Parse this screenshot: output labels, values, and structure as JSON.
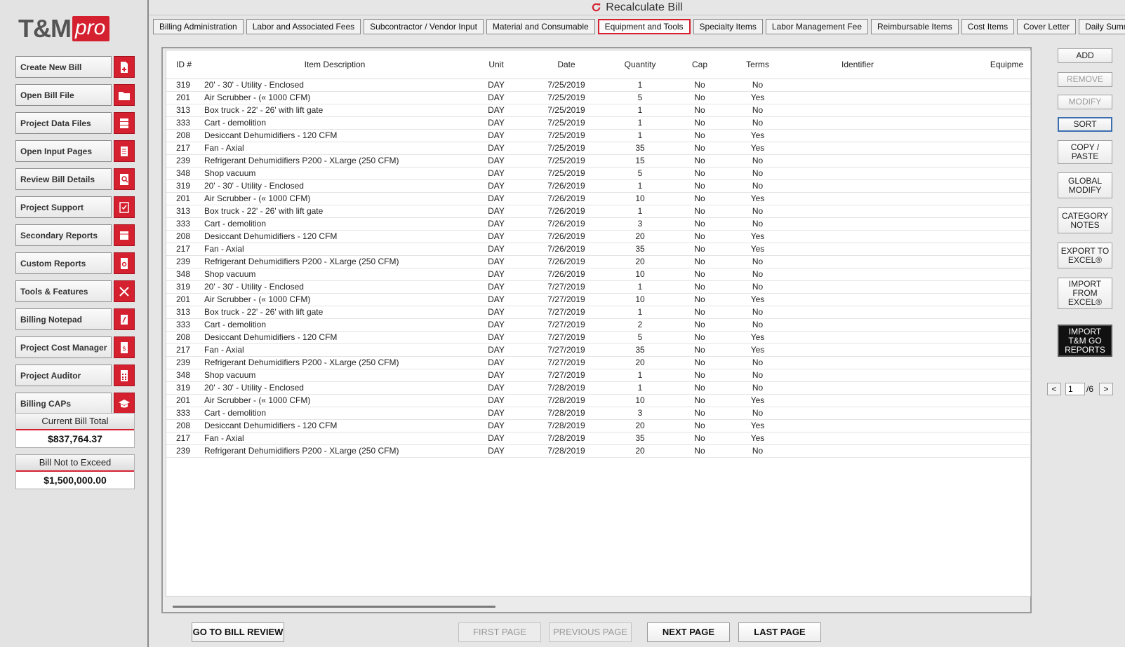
{
  "logo": {
    "tm": "T&M",
    "pro": "pro"
  },
  "sidebar": {
    "items": [
      {
        "label": "Create New Bill",
        "icon": "new-document-icon"
      },
      {
        "label": "Open Bill File",
        "icon": "folder-icon"
      },
      {
        "label": "Project Data Files",
        "icon": "database-icon"
      },
      {
        "label": "Open Input Pages",
        "icon": "input-pages-icon"
      },
      {
        "label": "Review Bill Details",
        "icon": "magnifier-icon"
      },
      {
        "label": "Project Support",
        "icon": "checklist-icon"
      },
      {
        "label": "Secondary Reports",
        "icon": "report-icon"
      },
      {
        "label": "Custom Reports",
        "icon": "gear-document-icon"
      },
      {
        "label": "Tools & Features",
        "icon": "tools-icon"
      },
      {
        "label": "Billing Notepad",
        "icon": "notepad-icon"
      },
      {
        "label": "Project Cost Manager",
        "icon": "dollar-document-icon"
      },
      {
        "label": "Project Auditor",
        "icon": "calculator-icon"
      },
      {
        "label": "Billing CAPs",
        "icon": "graduation-cap-icon"
      }
    ],
    "current_total": {
      "title": "Current Bill Total",
      "value": "$837,764.37"
    },
    "not_to_exceed": {
      "title": "Bill Not to Exceed",
      "value": "$1,500,000.00"
    }
  },
  "header": {
    "recalculate_label": "Recalculate Bill",
    "recalculate_icon": "refresh-icon"
  },
  "tabs": [
    {
      "label": "Billing Administration",
      "active": false
    },
    {
      "label": "Labor and Associated Fees",
      "active": false
    },
    {
      "label": "Subcontractor / Vendor Input",
      "active": false
    },
    {
      "label": "Material and Consumable",
      "active": false
    },
    {
      "label": "Equipment and Tools",
      "active": true
    },
    {
      "label": "Specialty Items",
      "active": false
    },
    {
      "label": "Labor Management Fee",
      "active": false
    },
    {
      "label": "Reimbursable Items",
      "active": false
    },
    {
      "label": "Cost Items",
      "active": false
    },
    {
      "label": "Cover Letter",
      "active": false
    },
    {
      "label": "Daily Summary",
      "active": false
    }
  ],
  "table": {
    "columns": [
      "ID #",
      "Item Description",
      "Unit",
      "Date",
      "Quantity",
      "Cap",
      "Terms",
      "Identifier",
      "Equipme"
    ],
    "rows": [
      [
        "319",
        "20' - 30' - Utility - Enclosed",
        "DAY",
        "7/25/2019",
        "1",
        "No",
        "No",
        ""
      ],
      [
        "201",
        "Air Scrubber - (« 1000 CFM)",
        "DAY",
        "7/25/2019",
        "5",
        "No",
        "Yes",
        ""
      ],
      [
        "313",
        "Box truck - 22' - 26' with lift gate",
        "DAY",
        "7/25/2019",
        "1",
        "No",
        "No",
        ""
      ],
      [
        "333",
        "Cart - demolition",
        "DAY",
        "7/25/2019",
        "1",
        "No",
        "No",
        ""
      ],
      [
        "208",
        "Desiccant Dehumidifiers - 120 CFM",
        "DAY",
        "7/25/2019",
        "1",
        "No",
        "Yes",
        ""
      ],
      [
        "217",
        "Fan - Axial",
        "DAY",
        "7/25/2019",
        "35",
        "No",
        "Yes",
        ""
      ],
      [
        "239",
        "Refrigerant Dehumidifiers P200 - XLarge (250 CFM)",
        "DAY",
        "7/25/2019",
        "15",
        "No",
        "No",
        ""
      ],
      [
        "348",
        "Shop vacuum",
        "DAY",
        "7/25/2019",
        "5",
        "No",
        "No",
        ""
      ],
      [
        "319",
        "20' - 30' - Utility - Enclosed",
        "DAY",
        "7/26/2019",
        "1",
        "No",
        "No",
        ""
      ],
      [
        "201",
        "Air Scrubber - (« 1000 CFM)",
        "DAY",
        "7/26/2019",
        "10",
        "No",
        "Yes",
        ""
      ],
      [
        "313",
        "Box truck - 22' - 26' with lift gate",
        "DAY",
        "7/26/2019",
        "1",
        "No",
        "No",
        ""
      ],
      [
        "333",
        "Cart - demolition",
        "DAY",
        "7/26/2019",
        "3",
        "No",
        "No",
        ""
      ],
      [
        "208",
        "Desiccant Dehumidifiers - 120 CFM",
        "DAY",
        "7/26/2019",
        "20",
        "No",
        "Yes",
        ""
      ],
      [
        "217",
        "Fan - Axial",
        "DAY",
        "7/26/2019",
        "35",
        "No",
        "Yes",
        ""
      ],
      [
        "239",
        "Refrigerant Dehumidifiers P200 - XLarge (250 CFM)",
        "DAY",
        "7/26/2019",
        "20",
        "No",
        "No",
        ""
      ],
      [
        "348",
        "Shop vacuum",
        "DAY",
        "7/26/2019",
        "10",
        "No",
        "No",
        ""
      ],
      [
        "319",
        "20' - 30' - Utility - Enclosed",
        "DAY",
        "7/27/2019",
        "1",
        "No",
        "No",
        ""
      ],
      [
        "201",
        "Air Scrubber - (« 1000 CFM)",
        "DAY",
        "7/27/2019",
        "10",
        "No",
        "Yes",
        ""
      ],
      [
        "313",
        "Box truck - 22' - 26' with lift gate",
        "DAY",
        "7/27/2019",
        "1",
        "No",
        "No",
        ""
      ],
      [
        "333",
        "Cart - demolition",
        "DAY",
        "7/27/2019",
        "2",
        "No",
        "No",
        ""
      ],
      [
        "208",
        "Desiccant Dehumidifiers - 120 CFM",
        "DAY",
        "7/27/2019",
        "5",
        "No",
        "Yes",
        ""
      ],
      [
        "217",
        "Fan - Axial",
        "DAY",
        "7/27/2019",
        "35",
        "No",
        "Yes",
        ""
      ],
      [
        "239",
        "Refrigerant Dehumidifiers P200 - XLarge (250 CFM)",
        "DAY",
        "7/27/2019",
        "20",
        "No",
        "No",
        ""
      ],
      [
        "348",
        "Shop vacuum",
        "DAY",
        "7/27/2019",
        "1",
        "No",
        "No",
        ""
      ],
      [
        "319",
        "20' - 30' - Utility - Enclosed",
        "DAY",
        "7/28/2019",
        "1",
        "No",
        "No",
        ""
      ],
      [
        "201",
        "Air Scrubber - (« 1000 CFM)",
        "DAY",
        "7/28/2019",
        "10",
        "No",
        "Yes",
        ""
      ],
      [
        "333",
        "Cart - demolition",
        "DAY",
        "7/28/2019",
        "3",
        "No",
        "No",
        ""
      ],
      [
        "208",
        "Desiccant Dehumidifiers - 120 CFM",
        "DAY",
        "7/28/2019",
        "20",
        "No",
        "Yes",
        ""
      ],
      [
        "217",
        "Fan - Axial",
        "DAY",
        "7/28/2019",
        "35",
        "No",
        "Yes",
        ""
      ],
      [
        "239",
        "Refrigerant Dehumidifiers P200 - XLarge (250 CFM)",
        "DAY",
        "7/28/2019",
        "20",
        "No",
        "No",
        ""
      ]
    ]
  },
  "right_buttons": {
    "add": "ADD",
    "remove": "REMOVE",
    "modify": "MODIFY",
    "sort": "SORT",
    "copy_paste_1": "COPY /",
    "copy_paste_2": "PASTE",
    "global_modify_1": "GLOBAL",
    "global_modify_2": "MODIFY",
    "category_notes_1": "CATEGORY",
    "category_notes_2": "NOTES",
    "export_excel_1": "EXPORT TO",
    "export_excel_2": "EXCEL®",
    "import_excel_1": "IMPORT",
    "import_excel_2": "FROM",
    "import_excel_3": "EXCEL®",
    "import_tmgo_1": "IMPORT",
    "import_tmgo_2": "T&M GO",
    "import_tmgo_3": "REPORTS"
  },
  "pager": {
    "prev": "<",
    "current": "1",
    "total": "/6",
    "next": ">"
  },
  "bottom": {
    "go_to_review": "GO TO BILL REVIEW",
    "first_page": "FIRST PAGE",
    "previous_page": "PREVIOUS PAGE",
    "next_page": "NEXT PAGE",
    "last_page": "LAST PAGE"
  },
  "colors": {
    "accent": "#d4202f",
    "sidebar_bg": "#e3e3e3",
    "selected_border": "#3a6fb0"
  }
}
